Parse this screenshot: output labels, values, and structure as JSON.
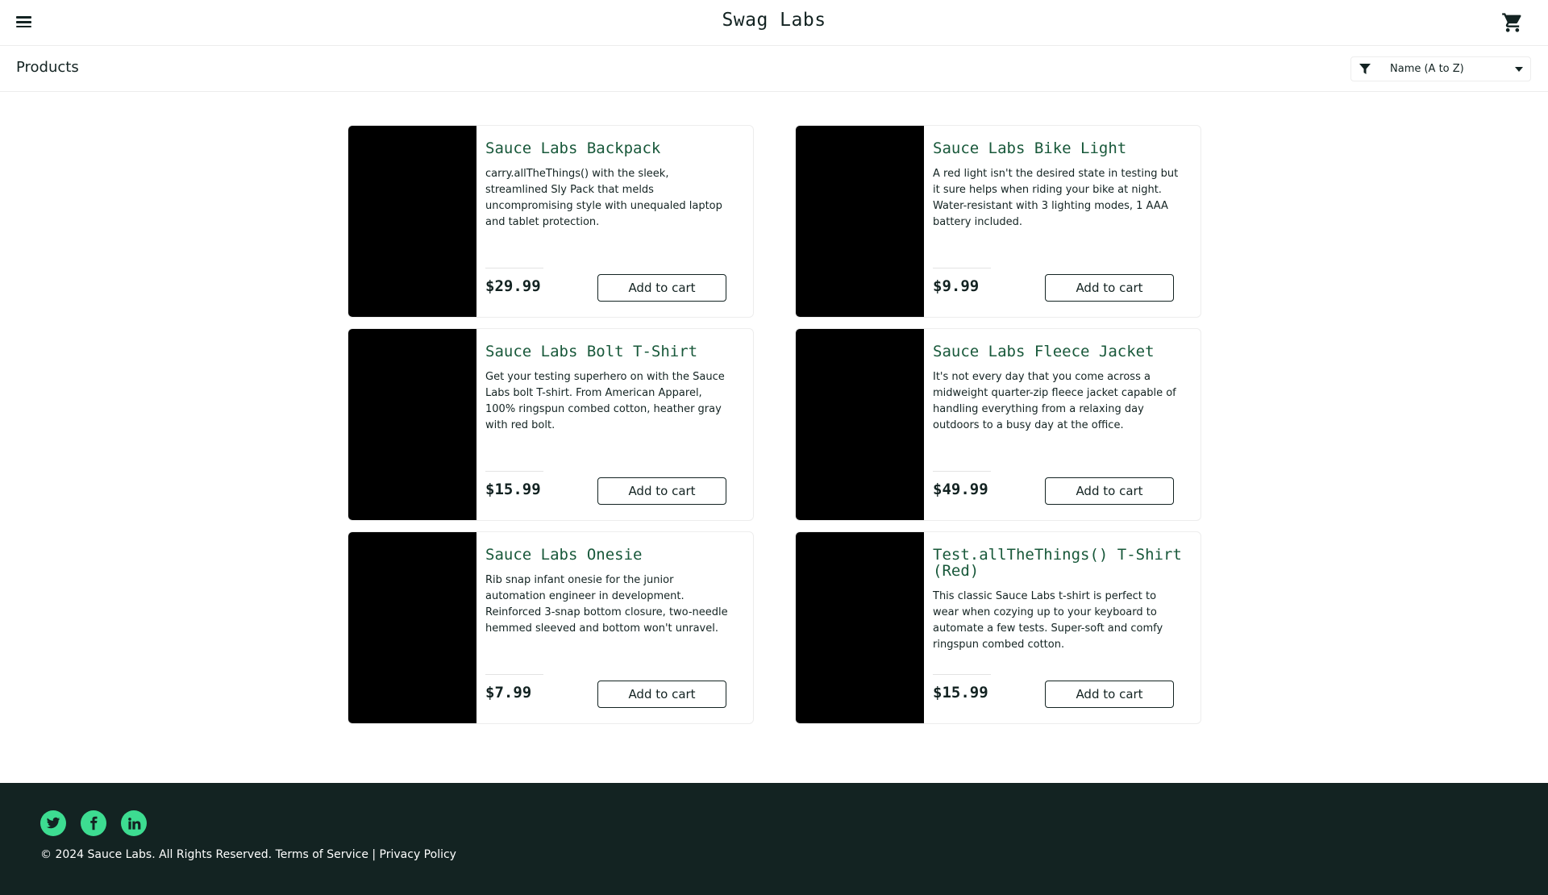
{
  "header": {
    "logo": "Swag Labs",
    "menu_icon": "hamburger-menu-icon",
    "cart_icon": "shopping-cart-icon"
  },
  "subheader": {
    "title": "Products",
    "filter_icon": "filter-funnel-icon",
    "sort": {
      "selected": "Name (A to Z)"
    }
  },
  "products": [
    {
      "name": "Sauce Labs Backpack",
      "description": "carry.allTheThings() with the sleek, streamlined Sly Pack that melds uncompromising style with unequaled laptop and tablet protection.",
      "price": "$29.99",
      "button": "Add to cart"
    },
    {
      "name": "Sauce Labs Bike Light",
      "description": "A red light isn't the desired state in testing but it sure helps when riding your bike at night. Water-resistant with 3 lighting modes, 1 AAA battery included.",
      "price": "$9.99",
      "button": "Add to cart"
    },
    {
      "name": "Sauce Labs Bolt T-Shirt",
      "description": "Get your testing superhero on with the Sauce Labs bolt T-shirt. From American Apparel, 100% ringspun combed cotton, heather gray with red bolt.",
      "price": "$15.99",
      "button": "Add to cart"
    },
    {
      "name": "Sauce Labs Fleece Jacket",
      "description": "It's not every day that you come across a midweight quarter-zip fleece jacket capable of handling everything from a relaxing day outdoors to a busy day at the office.",
      "price": "$49.99",
      "button": "Add to cart"
    },
    {
      "name": "Sauce Labs Onesie",
      "description": "Rib snap infant onesie for the junior automation engineer in development. Reinforced 3-snap bottom closure, two-needle hemmed sleeved and bottom won't unravel.",
      "price": "$7.99",
      "button": "Add to cart"
    },
    {
      "name": "Test.allTheThings() T-Shirt (Red)",
      "description": "This classic Sauce Labs t-shirt is perfect to wear when cozying up to your keyboard to automate a few tests. Super-soft and comfy ringspun combed cotton.",
      "price": "$15.99",
      "button": "Add to cart"
    }
  ],
  "footer": {
    "social": [
      {
        "icon": "twitter-icon"
      },
      {
        "icon": "facebook-icon"
      },
      {
        "icon": "linkedin-icon"
      }
    ],
    "copy": "© 2024 Sauce Labs. All Rights Reserved. Terms of Service | Privacy Policy"
  }
}
